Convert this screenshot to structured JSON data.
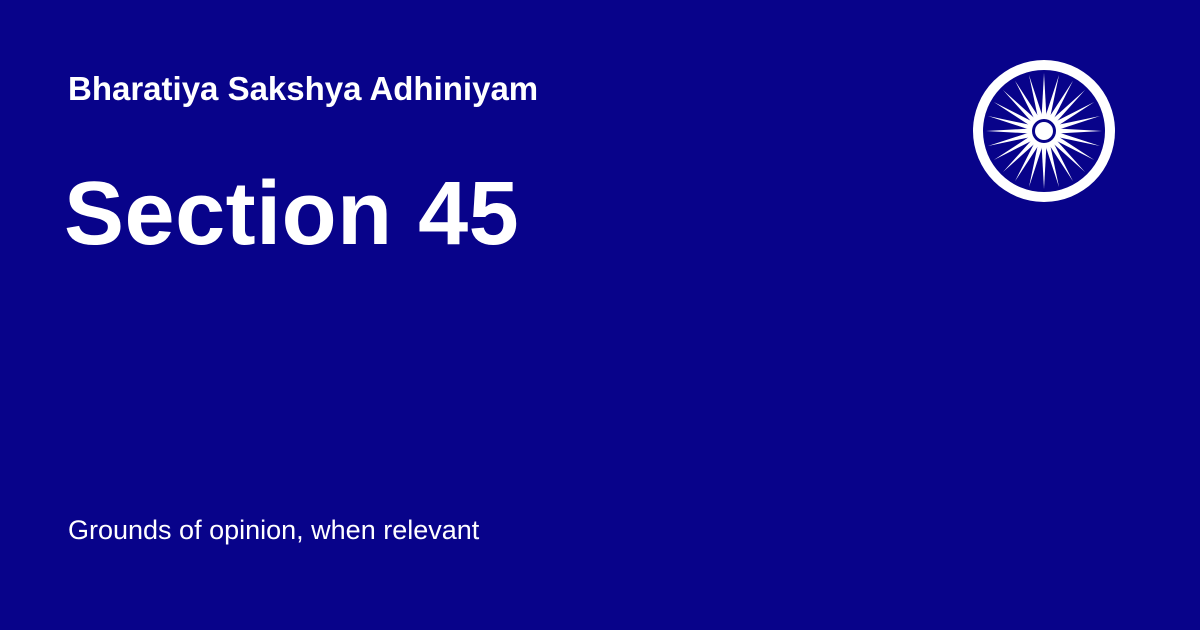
{
  "colors": {
    "background": "#08038A",
    "foreground": "#FFFFFF"
  },
  "header": {
    "act_name": "Bharatiya Sakshya Adhiniyam"
  },
  "section": {
    "title": "Section 45",
    "description": "Grounds of opinion, when relevant"
  },
  "emblem": {
    "icon": "ashoka-chakra-icon",
    "spokes": 24
  }
}
